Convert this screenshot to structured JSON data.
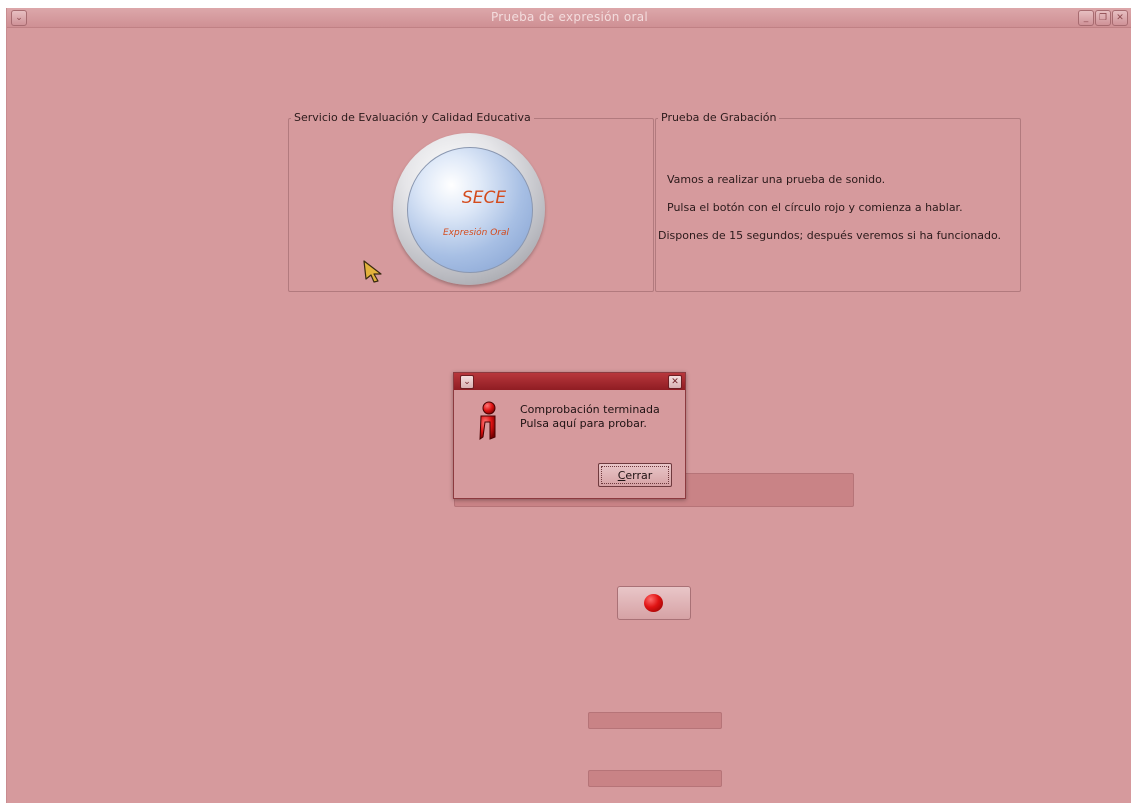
{
  "window": {
    "title": "Prueba de expresión oral",
    "menu_glyph": "⌄",
    "minimize_glyph": "_",
    "restore_glyph": "❐",
    "close_glyph": "✕"
  },
  "left_group": {
    "title": "Servicio de Evaluación y Calidad Educativa",
    "logo": {
      "title": "SECE",
      "subtitle": "Expresión Oral"
    }
  },
  "right_group": {
    "title": "Prueba de Grabación",
    "lines": [
      "Vamos a realizar una prueba de sonido.",
      "Pulsa el botón con el círculo rojo  y comienza a hablar.",
      "Dispones de 15 segundos; después veremos si ha funcionado."
    ]
  },
  "dialog": {
    "menu_glyph": "⌄",
    "close_glyph": "✕",
    "message_line1": "Comprobación terminada",
    "message_line2": "Pulsa aquí para probar.",
    "close_button_label": "Cerrar",
    "close_button_mnemonic": "C",
    "close_button_rest": "errar"
  },
  "colors": {
    "window_bg": "#d69a9d",
    "dialog_titlebar": "#a52a30",
    "record_dot": "#e01313",
    "logo_text": "#d44b1d"
  }
}
